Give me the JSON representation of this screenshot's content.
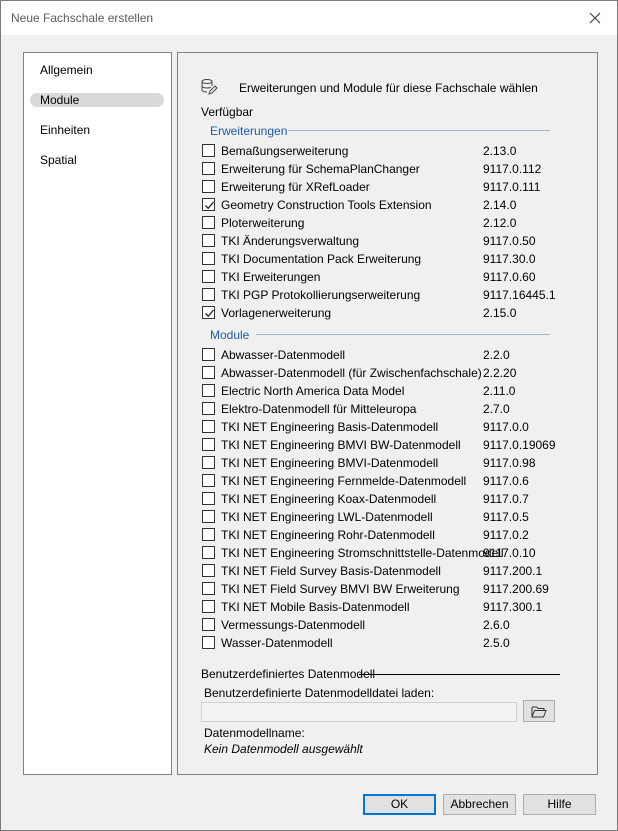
{
  "window": {
    "title": "Neue Fachschale erstellen"
  },
  "nav": {
    "items": [
      {
        "label": "Allgemein",
        "selected": false
      },
      {
        "label": "Module",
        "selected": true
      },
      {
        "label": "Einheiten",
        "selected": false
      },
      {
        "label": "Spatial",
        "selected": false
      }
    ]
  },
  "content": {
    "header": "Erweiterungen und Module für diese Fachschale wählen",
    "available_label": "Verfügbar",
    "extensions": {
      "title": "Erweiterungen",
      "items": [
        {
          "label": "Bemaßungserweiterung",
          "version": "2.13.0",
          "checked": false
        },
        {
          "label": "Erweiterung für SchemaPlanChanger",
          "version": "9117.0.112",
          "checked": false
        },
        {
          "label": "Erweiterung für XRefLoader",
          "version": "9117.0.111",
          "checked": false
        },
        {
          "label": "Geometry Construction Tools Extension",
          "version": "2.14.0",
          "checked": true
        },
        {
          "label": "Ploterweiterung",
          "version": "2.12.0",
          "checked": false
        },
        {
          "label": "TKI Änderungsverwaltung",
          "version": "9117.0.50",
          "checked": false
        },
        {
          "label": "TKI Documentation Pack Erweiterung",
          "version": "9117.30.0",
          "checked": false
        },
        {
          "label": "TKI Erweiterungen",
          "version": "9117.0.60",
          "checked": false
        },
        {
          "label": "TKI PGP Protokollierungserweiterung",
          "version": "9117.16445.1",
          "checked": false
        },
        {
          "label": "Vorlagenerweiterung",
          "version": "2.15.0",
          "checked": true
        }
      ]
    },
    "modules": {
      "title": "Module",
      "items": [
        {
          "label": "Abwasser-Datenmodell",
          "version": "2.2.0",
          "checked": false
        },
        {
          "label": "Abwasser-Datenmodell (für Zwischenfachschale)",
          "version": "2.2.20",
          "checked": false
        },
        {
          "label": "Electric North America Data Model",
          "version": "2.11.0",
          "checked": false
        },
        {
          "label": "Elektro-Datenmodell für Mitteleuropa",
          "version": "2.7.0",
          "checked": false
        },
        {
          "label": "TKI NET Engineering Basis-Datenmodell",
          "version": "9117.0.0",
          "checked": false
        },
        {
          "label": "TKI NET Engineering BMVI BW-Datenmodell",
          "version": "9117.0.19069",
          "checked": false
        },
        {
          "label": "TKI NET Engineering BMVI-Datenmodell",
          "version": "9117.0.98",
          "checked": false
        },
        {
          "label": "TKI NET Engineering Fernmelde-Datenmodell",
          "version": "9117.0.6",
          "checked": false
        },
        {
          "label": "TKI NET Engineering Koax-Datenmodell",
          "version": "9117.0.7",
          "checked": false
        },
        {
          "label": "TKI NET Engineering LWL-Datenmodell",
          "version": "9117.0.5",
          "checked": false
        },
        {
          "label": "TKI NET Engineering Rohr-Datenmodell",
          "version": "9117.0.2",
          "checked": false
        },
        {
          "label": "TKI NET Engineering Stromschnittstelle-Datenmodell",
          "version": "9117.0.10",
          "checked": false
        },
        {
          "label": "TKI NET Field Survey Basis-Datenmodell",
          "version": "9117.200.1",
          "checked": false
        },
        {
          "label": "TKI NET Field Survey BMVI BW Erweiterung",
          "version": "9117.200.69",
          "checked": false
        },
        {
          "label": "TKI NET Mobile Basis-Datenmodell",
          "version": "9117.300.1",
          "checked": false
        },
        {
          "label": "Vermessungs-Datenmodell",
          "version": "2.6.0",
          "checked": false
        },
        {
          "label": "Wasser-Datenmodell",
          "version": "2.5.0",
          "checked": false
        }
      ]
    },
    "custom": {
      "title": "Benutzerdefiniertes Datenmodell",
      "file_label": "Benutzerdefinierte Datenmodelldatei laden:",
      "file_value": "",
      "model_name_label": "Datenmodellname:",
      "model_name_value": "Kein Datenmodell ausgewählt"
    }
  },
  "buttons": {
    "ok": "OK",
    "cancel": "Abbrechen",
    "help": "Hilfe"
  }
}
